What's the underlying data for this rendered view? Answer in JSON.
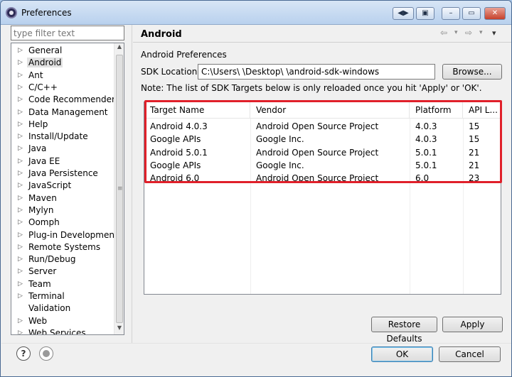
{
  "window": {
    "title": "Preferences",
    "title_buttons": [
      "◀▶",
      "▣",
      "–",
      "▭",
      "✕"
    ]
  },
  "sidebar": {
    "filter_placeholder": "type filter text",
    "items": [
      {
        "label": "General",
        "arrow": "▷",
        "selected": false
      },
      {
        "label": "Android",
        "arrow": "▷",
        "selected": true
      },
      {
        "label": "Ant",
        "arrow": "▷",
        "selected": false
      },
      {
        "label": "C/C++",
        "arrow": "▷",
        "selected": false
      },
      {
        "label": "Code Recommenders",
        "arrow": "▷",
        "selected": false
      },
      {
        "label": "Data Management",
        "arrow": "▷",
        "selected": false
      },
      {
        "label": "Help",
        "arrow": "▷",
        "selected": false
      },
      {
        "label": "Install/Update",
        "arrow": "▷",
        "selected": false
      },
      {
        "label": "Java",
        "arrow": "▷",
        "selected": false
      },
      {
        "label": "Java EE",
        "arrow": "▷",
        "selected": false
      },
      {
        "label": "Java Persistence",
        "arrow": "▷",
        "selected": false
      },
      {
        "label": "JavaScript",
        "arrow": "▷",
        "selected": false
      },
      {
        "label": "Maven",
        "arrow": "▷",
        "selected": false
      },
      {
        "label": "Mylyn",
        "arrow": "▷",
        "selected": false
      },
      {
        "label": "Oomph",
        "arrow": "▷",
        "selected": false
      },
      {
        "label": "Plug-in Development",
        "arrow": "▷",
        "selected": false
      },
      {
        "label": "Remote Systems",
        "arrow": "▷",
        "selected": false
      },
      {
        "label": "Run/Debug",
        "arrow": "▷",
        "selected": false
      },
      {
        "label": "Server",
        "arrow": "▷",
        "selected": false
      },
      {
        "label": "Team",
        "arrow": "▷",
        "selected": false
      },
      {
        "label": "Terminal",
        "arrow": "▷",
        "selected": false
      },
      {
        "label": "Validation",
        "arrow": "",
        "selected": false
      },
      {
        "label": "Web",
        "arrow": "▷",
        "selected": false
      },
      {
        "label": "Web Services",
        "arrow": "▷",
        "selected": false
      }
    ]
  },
  "page": {
    "title": "Android",
    "nav": [
      "⇦",
      "▾",
      "⇨",
      "▾",
      "▾"
    ],
    "section_label": "Android Preferences",
    "sdk_label": "SDK Location:",
    "sdk_value": "C:\\Users\\        \\Desktop\\          \\android-sdk-windows",
    "browse_button": "Browse...",
    "note": "Note: The list of SDK Targets below is only reloaded once you hit 'Apply' or 'OK'.",
    "table": {
      "columns": [
        "Target Name",
        "Vendor",
        "Platform",
        "API L..."
      ],
      "rows": [
        [
          "Android 4.0.3",
          "Android Open Source Project",
          "4.0.3",
          "15"
        ],
        [
          "Google APIs",
          "Google Inc.",
          "4.0.3",
          "15"
        ],
        [
          "Android 5.0.1",
          "Android Open Source Project",
          "5.0.1",
          "21"
        ],
        [
          "Google APIs",
          "Google Inc.",
          "5.0.1",
          "21"
        ],
        [
          "Android 6.0",
          "Android Open Source Project",
          "6.0",
          "23"
        ]
      ]
    },
    "restore_defaults_button": "Restore Defaults",
    "apply_button": "Apply"
  },
  "footer": {
    "help_icon": "?",
    "ok_button": "OK",
    "cancel_button": "Cancel"
  },
  "colors": {
    "highlight": "#e0202a",
    "titlebar": "#c6d9f0"
  }
}
